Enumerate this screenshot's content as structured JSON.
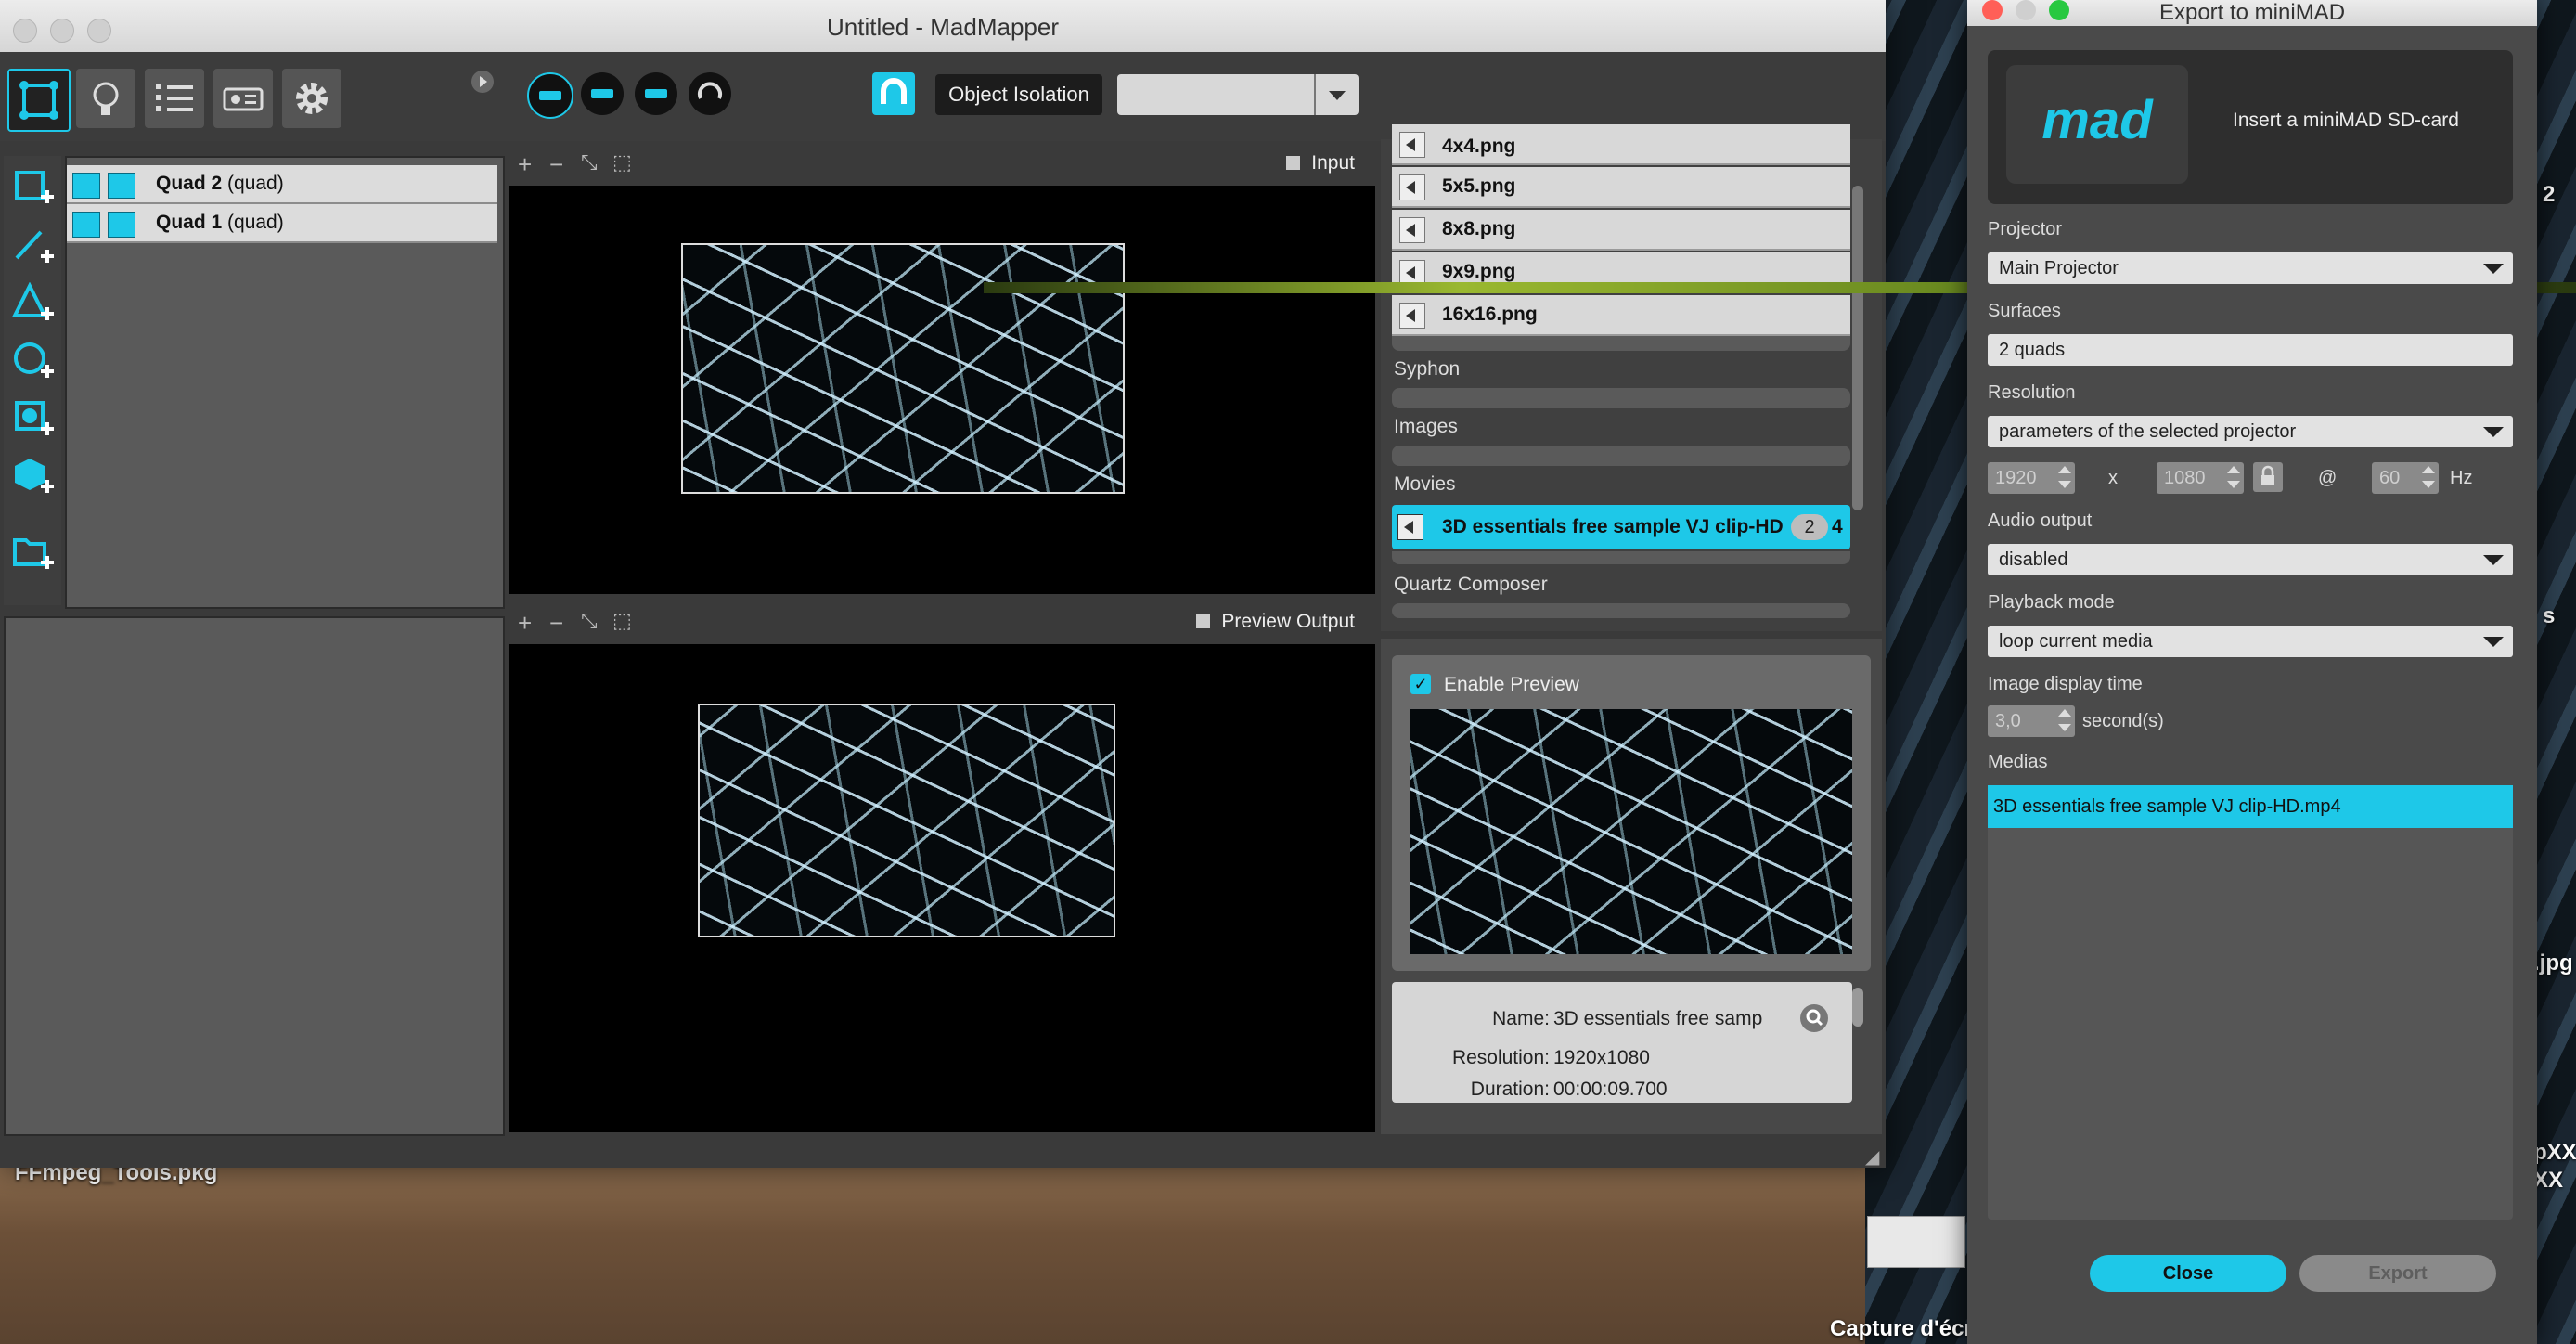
{
  "desktop": {
    "file_label": "FFmpeg_Tools.pkg",
    "capture_label": "Capture d'écran",
    "edge_fragments": [
      "2",
      "s",
      ".jpg",
      "pXX",
      "XX"
    ]
  },
  "window": {
    "title": "Untitled - MadMapper"
  },
  "toolbar": {
    "object_isolation_label": "Object Isolation",
    "object_isolation_value": ""
  },
  "surfaces": [
    {
      "name": "Quad 2",
      "type": "(quad)"
    },
    {
      "name": "Quad 1",
      "type": "(quad)"
    }
  ],
  "input_view": {
    "label": "Input"
  },
  "output_view": {
    "label": "Preview Output"
  },
  "library": {
    "images": [
      "4x4.png",
      "5x5.png",
      "8x8.png",
      "9x9.png",
      "16x16.png"
    ],
    "sections": {
      "syphon": "Syphon",
      "images": "Images",
      "movies": "Movies",
      "quartz": "Quartz Composer"
    },
    "movie": {
      "name": "3D essentials free sample VJ clip-HD",
      "badge": "2",
      "trail": "4"
    }
  },
  "preview": {
    "enable_label": "Enable Preview",
    "enabled": true
  },
  "media_info": {
    "name_label": "Name:",
    "name_value": "3D essentials free samp",
    "resolution_label": "Resolution:",
    "resolution_value": "1920x1080",
    "duration_label": "Duration:",
    "duration_value": "00:00:09.700"
  },
  "export": {
    "title": "Export to miniMAD",
    "logo_text": "mad",
    "sd_prompt": "Insert a miniMAD SD-card",
    "projector_label": "Projector",
    "projector_value": "Main Projector",
    "surfaces_label": "Surfaces",
    "surfaces_value": "2 quads",
    "resolution_label": "Resolution",
    "resolution_value": "parameters of the selected projector",
    "width": "1920",
    "x_sep": "x",
    "height": "1080",
    "at_sep": "@",
    "hz": "60",
    "hz_unit": "Hz",
    "audio_label": "Audio output",
    "audio_value": "disabled",
    "playback_label": "Playback mode",
    "playback_value": "loop current media",
    "display_time_label": "Image display time",
    "display_time_value": "3,0",
    "display_time_unit": "second(s)",
    "medias_label": "Medias",
    "medias": [
      "3D essentials free sample VJ clip-HD.mp4"
    ],
    "close_label": "Close",
    "export_label": "Export"
  },
  "colors": {
    "accent": "#1ec8e8",
    "panel": "#3a3a3a"
  }
}
